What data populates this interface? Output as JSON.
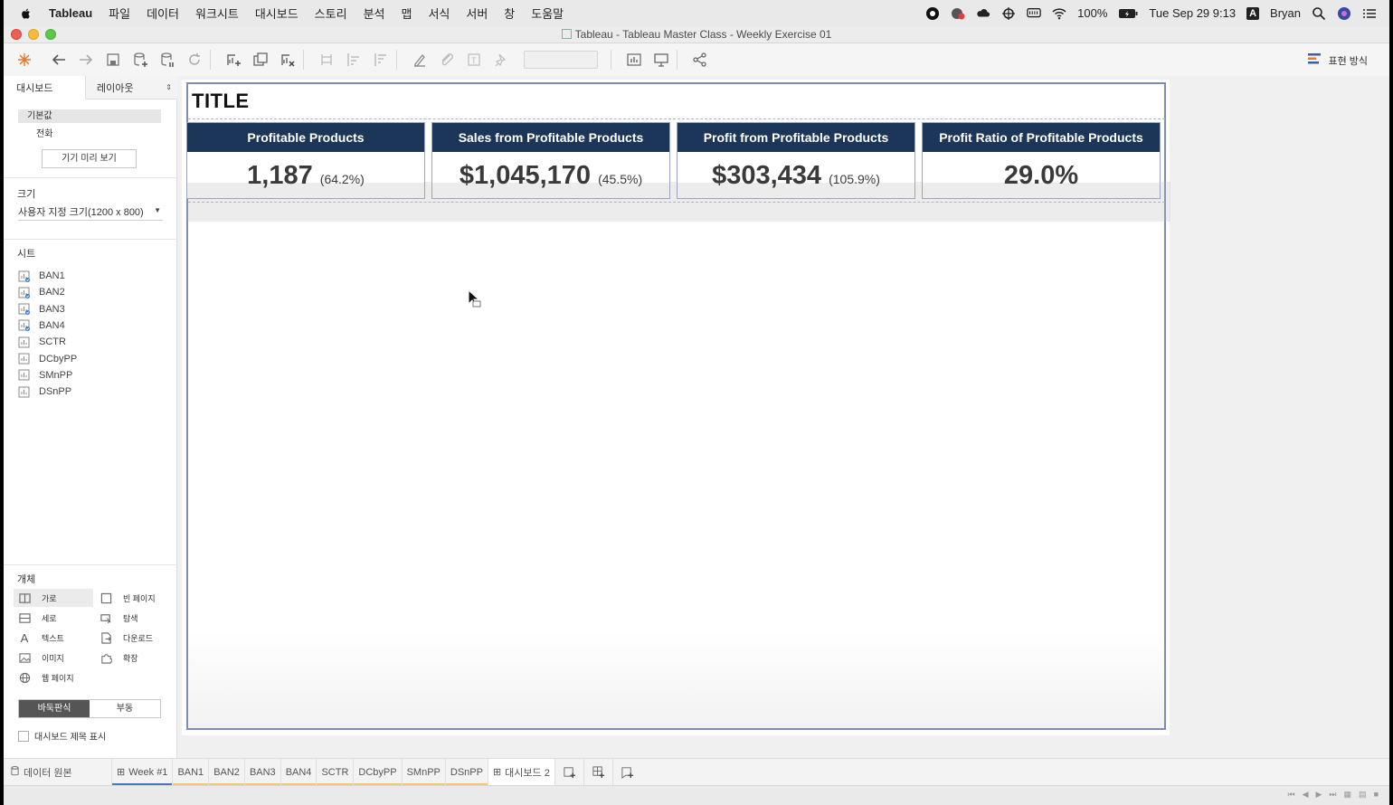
{
  "menubar": {
    "app_name": "Tableau",
    "items": [
      "파일",
      "데이터",
      "워크시트",
      "대시보드",
      "스토리",
      "분석",
      "맵",
      "서식",
      "서버",
      "창",
      "도움말"
    ],
    "battery": "100%",
    "clock": "Tue Sep 29  9:13",
    "input_source": "A",
    "user": "Bryan"
  },
  "window": {
    "title": "Tableau - Tableau Master Class - Weekly Exercise 01"
  },
  "toolbar": {
    "show_me_label": "표현 방식"
  },
  "left_pane": {
    "tabs": [
      "대시보드",
      "레이아웃"
    ],
    "devices": {
      "default_label": "기본값",
      "phone_label": "전화",
      "preview_button": "기기 미리 보기"
    },
    "size": {
      "label": "크기",
      "value": "사용자 지정 크기(1200 x 800)"
    },
    "sheets": {
      "label": "시트",
      "items": [
        "BAN1",
        "BAN2",
        "BAN3",
        "BAN4",
        "SCTR",
        "DCbyPP",
        "SMnPP",
        "DSnPP"
      ]
    },
    "objects": {
      "label": "개체",
      "items": [
        "가로",
        "빈 페이지",
        "세로",
        "탐색",
        "텍스트",
        "다운로드",
        "이미지",
        "확장",
        "웹 페이지"
      ]
    },
    "layout_toggle": [
      "바둑판식",
      "부동"
    ],
    "show_title_label": "대시보드 제목 표시"
  },
  "dashboard": {
    "title": "TITLE",
    "bans": [
      {
        "header": "Profitable Products",
        "value": "1,187",
        "pct": "(64.2%)"
      },
      {
        "header": "Sales from Profitable Products",
        "value": "$1,045,170",
        "pct": "(45.5%)"
      },
      {
        "header": "Profit from Profitable Products",
        "value": "$303,434",
        "pct": "(105.9%)"
      },
      {
        "header": "Profit Ratio of Profitable Products",
        "value": "29.0%",
        "pct": ""
      }
    ]
  },
  "tabbar": {
    "data_source": "데이터 원본",
    "tabs": [
      "Week #1",
      "BAN1",
      "BAN2",
      "BAN3",
      "BAN4",
      "SCTR",
      "DCbyPP",
      "SMnPP",
      "DSnPP",
      "대시보드 2"
    ]
  },
  "colors": {
    "ban_header": "#1b3659",
    "frame_border": "#7f8db5",
    "sheet_tab_accent": "#f0c878",
    "dashboard_tab_accent": "#4a78b5"
  }
}
